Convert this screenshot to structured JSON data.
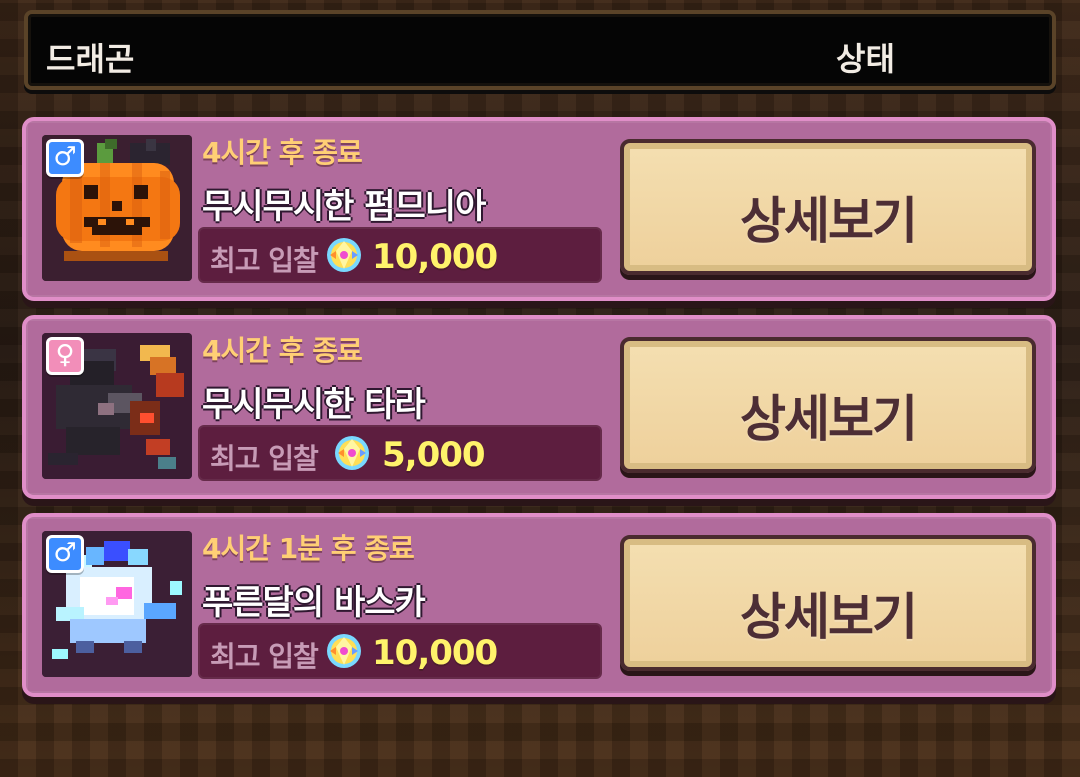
{
  "header": {
    "dragon_label": "드래곤",
    "status_label": "상태"
  },
  "colors": {
    "card_fill": "#b16b9c",
    "card_border": "#e08ec8",
    "time_text": "#ffcf75",
    "bid_text": "#fff36b",
    "button_fill": "#f2d8a8",
    "button_text": "#4d2e35",
    "male_badge": "#3d8cff",
    "female_badge": "#f28eb9"
  },
  "listings": [
    {
      "gender_icon": "male-icon",
      "gender_symbol": "♂",
      "portrait_icon": "pumpkin-dragon-icon",
      "end_time": "4시간 후 종료",
      "name": "무시무시한 펌므니아",
      "bid_label": "최고 입찰",
      "bid_icon": "diamond-coin-icon",
      "bid_amount": "10,000",
      "button_label": "상세보기"
    },
    {
      "gender_icon": "female-icon",
      "gender_symbol": "♀",
      "portrait_icon": "dark-dragon-icon",
      "end_time": "4시간 후 종료",
      "name": "무시무시한 타라",
      "bid_label": "최고 입찰",
      "bid_icon": "diamond-coin-icon",
      "bid_amount": "5,000",
      "button_label": "상세보기"
    },
    {
      "gender_icon": "male-icon",
      "gender_symbol": "♂",
      "portrait_icon": "blue-moon-dragon-icon",
      "end_time": "4시간 1분 후 종료",
      "name": "푸른달의 바스카",
      "bid_label": "최고 입찰",
      "bid_icon": "diamond-coin-icon",
      "bid_amount": "10,000",
      "button_label": "상세보기"
    }
  ]
}
